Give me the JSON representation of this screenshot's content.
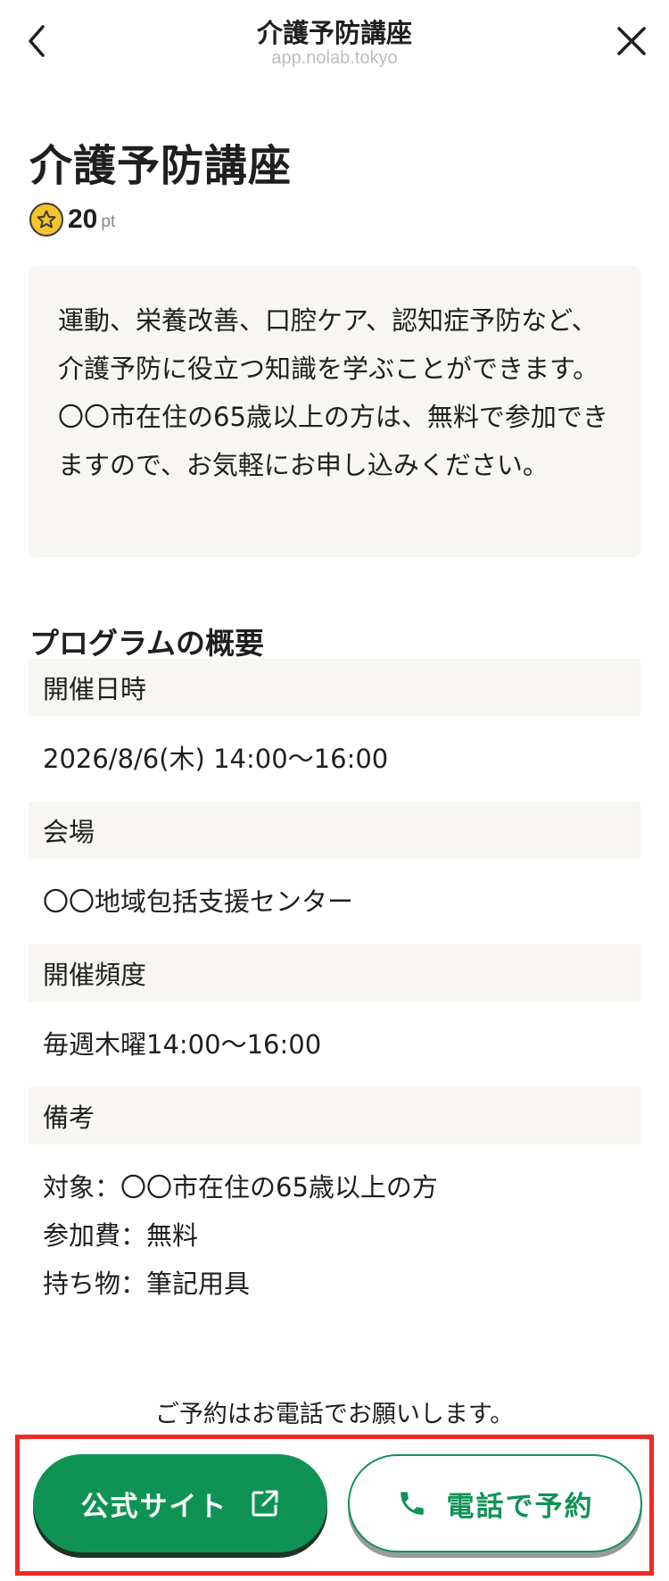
{
  "header": {
    "title": "介護予防講座",
    "url": "app.nolab.tokyo"
  },
  "page": {
    "title": "介護予防講座",
    "points_value": "20",
    "points_unit": "pt",
    "description": "運動、栄養改善、口腔ケア、認知症予防など、介護予防に役立つ知識を学ぶことができます。〇〇市在住の65歳以上の方は、無料で参加できますので、お気軽にお申し込みください。"
  },
  "overview": {
    "title": "プログラムの概要",
    "rows": [
      {
        "label": "開催日時",
        "value_lines": [
          "2026/8/6(木) 14:00〜16:00"
        ]
      },
      {
        "label": "会場",
        "value_lines": [
          "〇〇地域包括支援センター"
        ]
      },
      {
        "label": "開催頻度",
        "value_lines": [
          "毎週木曜14:00〜16:00"
        ]
      },
      {
        "label": "備考",
        "value_lines": [
          "対象：〇〇市在住の65歳以上の方",
          "参加費：無料",
          "持ち物：筆記用具"
        ]
      }
    ]
  },
  "footer": {
    "notice": "ご予約はお電話でお願いします。",
    "official_button_label": "公式サイト",
    "phone_button_label": "電話で予約"
  },
  "icons": {
    "back": "chevron-left-icon",
    "close": "close-icon",
    "star": "star-icon",
    "external": "external-link-icon",
    "phone": "phone-icon"
  },
  "colors": {
    "accent_green": "#0f9355",
    "star_yellow": "#f5c32c",
    "highlight_red": "#ee2a24",
    "panel_beige": "#f7f6f2"
  }
}
